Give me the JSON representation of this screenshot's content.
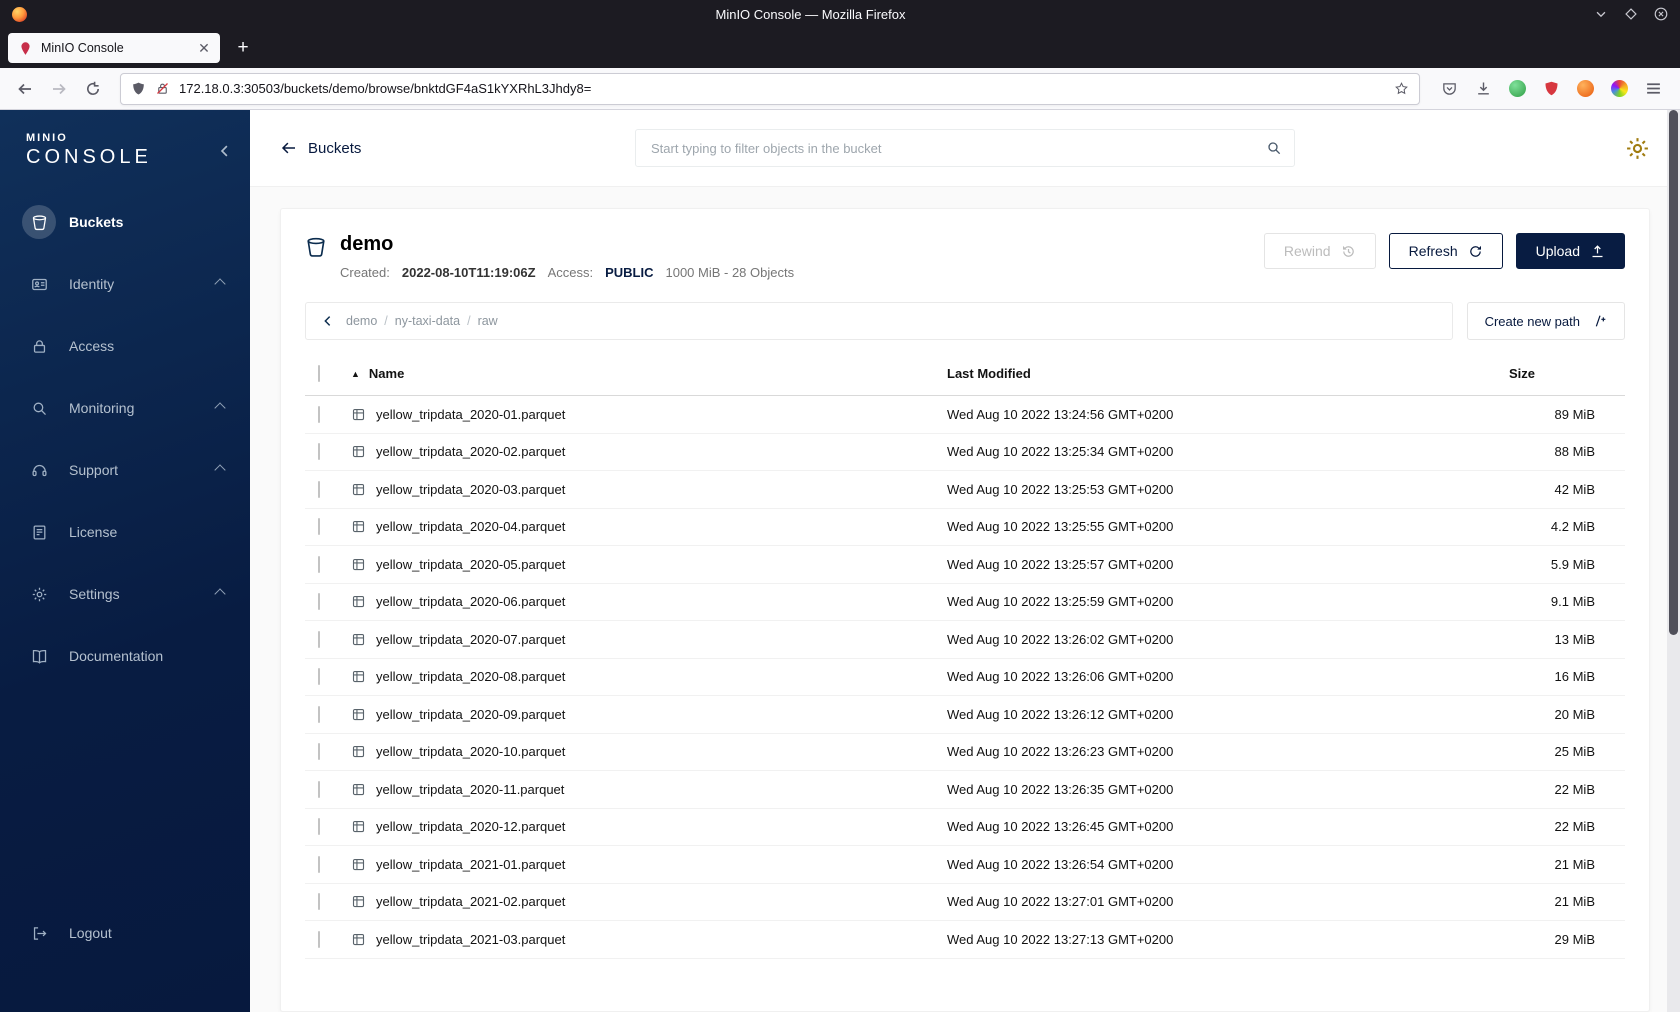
{
  "colors": {
    "accent_navy": "#081C42",
    "minio_red": "#C72E49",
    "gear_gold": "#A07C10"
  },
  "titlebar": {
    "title": "MinIO Console — Mozilla Firefox"
  },
  "tabs": {
    "active_tab": "MinIO Console"
  },
  "urlbar": {
    "url": "172.18.0.3:30503/buckets/demo/browse/bnktdGF4aS1kYXRhL3Jhdy8="
  },
  "sidebar": {
    "logo_small": "MINIO",
    "logo_large": "CONSOLE",
    "items": [
      {
        "label": "Buckets"
      },
      {
        "label": "Identity"
      },
      {
        "label": "Access"
      },
      {
        "label": "Monitoring"
      },
      {
        "label": "Support"
      },
      {
        "label": "License"
      },
      {
        "label": "Settings"
      },
      {
        "label": "Documentation"
      }
    ],
    "logout_label": "Logout"
  },
  "topbar": {
    "back_label": "Buckets",
    "search_placeholder": "Start typing to filter objects in the bucket"
  },
  "bucket": {
    "name": "demo",
    "created_label": "Created:",
    "created_value": "2022-08-10T11:19:06Z",
    "access_label": "Access:",
    "access_value": "PUBLIC",
    "stats": "1000 MiB - 28 Objects",
    "rewind_label": "Rewind",
    "refresh_label": "Refresh",
    "upload_label": "Upload"
  },
  "browse": {
    "breadcrumb": [
      "demo",
      "ny-taxi-data",
      "raw"
    ],
    "create_path_label": "Create new path"
  },
  "table": {
    "columns": {
      "name": "Name",
      "modified": "Last Modified",
      "size": "Size"
    },
    "rows": [
      {
        "name": "yellow_tripdata_2020-01.parquet",
        "modified": "Wed Aug 10 2022 13:24:56 GMT+0200",
        "size": "89 MiB"
      },
      {
        "name": "yellow_tripdata_2020-02.parquet",
        "modified": "Wed Aug 10 2022 13:25:34 GMT+0200",
        "size": "88 MiB"
      },
      {
        "name": "yellow_tripdata_2020-03.parquet",
        "modified": "Wed Aug 10 2022 13:25:53 GMT+0200",
        "size": "42 MiB"
      },
      {
        "name": "yellow_tripdata_2020-04.parquet",
        "modified": "Wed Aug 10 2022 13:25:55 GMT+0200",
        "size": "4.2 MiB"
      },
      {
        "name": "yellow_tripdata_2020-05.parquet",
        "modified": "Wed Aug 10 2022 13:25:57 GMT+0200",
        "size": "5.9 MiB"
      },
      {
        "name": "yellow_tripdata_2020-06.parquet",
        "modified": "Wed Aug 10 2022 13:25:59 GMT+0200",
        "size": "9.1 MiB"
      },
      {
        "name": "yellow_tripdata_2020-07.parquet",
        "modified": "Wed Aug 10 2022 13:26:02 GMT+0200",
        "size": "13 MiB"
      },
      {
        "name": "yellow_tripdata_2020-08.parquet",
        "modified": "Wed Aug 10 2022 13:26:06 GMT+0200",
        "size": "16 MiB"
      },
      {
        "name": "yellow_tripdata_2020-09.parquet",
        "modified": "Wed Aug 10 2022 13:26:12 GMT+0200",
        "size": "20 MiB"
      },
      {
        "name": "yellow_tripdata_2020-10.parquet",
        "modified": "Wed Aug 10 2022 13:26:23 GMT+0200",
        "size": "25 MiB"
      },
      {
        "name": "yellow_tripdata_2020-11.parquet",
        "modified": "Wed Aug 10 2022 13:26:35 GMT+0200",
        "size": "22 MiB"
      },
      {
        "name": "yellow_tripdata_2020-12.parquet",
        "modified": "Wed Aug 10 2022 13:26:45 GMT+0200",
        "size": "22 MiB"
      },
      {
        "name": "yellow_tripdata_2021-01.parquet",
        "modified": "Wed Aug 10 2022 13:26:54 GMT+0200",
        "size": "21 MiB"
      },
      {
        "name": "yellow_tripdata_2021-02.parquet",
        "modified": "Wed Aug 10 2022 13:27:01 GMT+0200",
        "size": "21 MiB"
      },
      {
        "name": "yellow_tripdata_2021-03.parquet",
        "modified": "Wed Aug 10 2022 13:27:13 GMT+0200",
        "size": "29 MiB"
      }
    ]
  }
}
